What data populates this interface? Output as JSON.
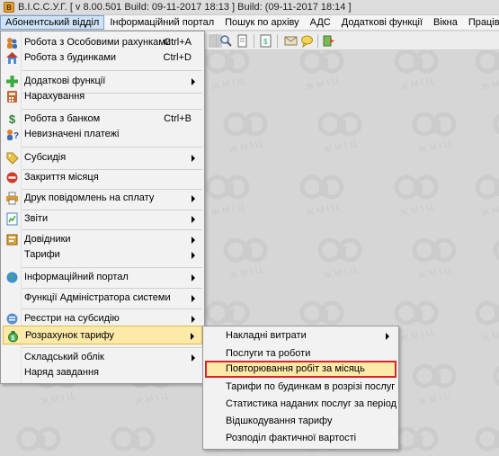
{
  "window": {
    "title": "В.І.С.С.У.Г. [ v 8.00.501 Build: 09-11-2017 18:13 ]   Build: (09-11-2017 18:14 ]"
  },
  "menubar": [
    {
      "label": "Абонентський відділ"
    },
    {
      "label": "Інформаційний портал"
    },
    {
      "label": "Пошук по архіву"
    },
    {
      "label": "АДС"
    },
    {
      "label": "Додаткові функції"
    },
    {
      "label": "Вікна"
    },
    {
      "label": "Працівники"
    }
  ],
  "main_menu": [
    {
      "label": "Робота з Особовими рахунками",
      "shortcut": "Ctrl+A",
      "icon": "people-icon"
    },
    {
      "label": "Робота з будинками",
      "shortcut": "Ctrl+D",
      "icon": "house-icon"
    },
    {
      "label": "Додаткові функції",
      "icon": "plus-icon"
    },
    {
      "label": "Нарахування",
      "icon": "calculator-icon"
    },
    {
      "label": "Робота з банком",
      "shortcut": "Ctrl+B",
      "icon": "dollar-icon"
    },
    {
      "label": "Невизначені платежі",
      "icon": "question-person-icon"
    },
    {
      "label": "Субсидія",
      "icon": "tag-icon"
    },
    {
      "label": "Закриття місяця",
      "icon": "no-entry-icon"
    },
    {
      "label": "Друк повідомлень на сплату",
      "icon": "printer-icon"
    },
    {
      "label": "Звіти",
      "icon": "report-icon"
    },
    {
      "label": "Довідники",
      "icon": "book-icon"
    },
    {
      "label": "Тарифи"
    },
    {
      "label": "Інформаційний портал",
      "icon": "globe-icon"
    },
    {
      "label": "Функції Адміністратора системи"
    },
    {
      "label": "Реєстри на субсидію",
      "icon": "registry-icon"
    },
    {
      "label": "Розрахунок тарифу",
      "icon": "money-bag-icon"
    },
    {
      "label": "Складський облік"
    },
    {
      "label": "Наряд завдання"
    }
  ],
  "submenu": [
    {
      "label": "Накладні витрати"
    },
    {
      "label": "Послуги та роботи"
    },
    {
      "label": "Повторювання робіт за місяць"
    },
    {
      "label": "Тарифи по будинкам в розрізі послуг"
    },
    {
      "label": "Статистика наданих послуг за період"
    },
    {
      "label": "Відшкодування тарифу"
    },
    {
      "label": "Розподіл фактичної вартості"
    }
  ],
  "watermark": {
    "text": "ЖМІЦ"
  },
  "colors": {
    "highlight": "#fde9a8",
    "selected_border": "#d9242a",
    "menubar_active": "#cfe3f7"
  }
}
